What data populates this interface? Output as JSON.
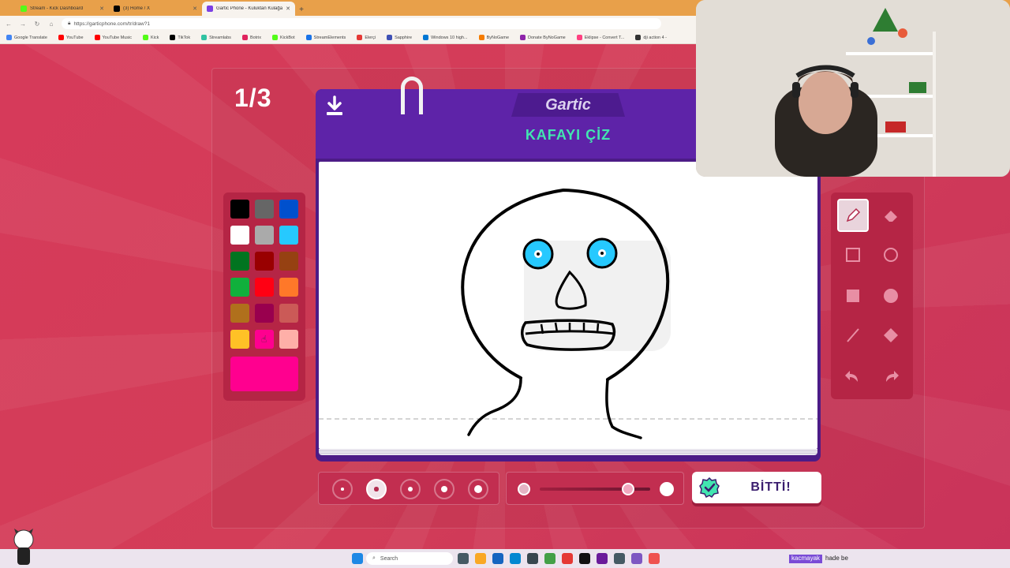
{
  "browser": {
    "tabs": [
      {
        "title": "Stream - Kick Dashboard",
        "color": "#53fc18",
        "active": false
      },
      {
        "title": "(3) Home / X",
        "color": "#000000",
        "active": false
      },
      {
        "title": "Gartic Phone - Kuluktan Kulağa",
        "color": "#7b3fe4",
        "active": true
      }
    ],
    "new_tab": "+",
    "url": "https://garticphone.com/tr/draw?1",
    "bookmarks": [
      {
        "label": "Google Translate",
        "color": "#4285f4"
      },
      {
        "label": "YouTube",
        "color": "#ff0000"
      },
      {
        "label": "YouTube Music",
        "color": "#ff0000"
      },
      {
        "label": "Kick",
        "color": "#53fc18"
      },
      {
        "label": "TikTok",
        "color": "#000000"
      },
      {
        "label": "Streamlabs",
        "color": "#31c3a2"
      },
      {
        "label": "Botrix",
        "color": "#e0245e"
      },
      {
        "label": "KickBot",
        "color": "#53fc18"
      },
      {
        "label": "StreamElements",
        "color": "#1a73e8"
      },
      {
        "label": "Elerçi",
        "color": "#e53935"
      },
      {
        "label": "Sapphire",
        "color": "#3f51b5"
      },
      {
        "label": "Windows 10 high...",
        "color": "#0078d4"
      },
      {
        "label": "ByNoGame",
        "color": "#f57c00"
      },
      {
        "label": "Donate ByNoGame",
        "color": "#8e24aa"
      },
      {
        "label": "Eklipse - Convert T...",
        "color": "#ff4081"
      },
      {
        "label": "dji action 4 -",
        "color": "#333333"
      }
    ]
  },
  "game": {
    "round_counter": "1/3",
    "logo": "Gartic",
    "prompt": "KAFAYI ÇİZ",
    "done_label": "BİTTİ!",
    "palette": [
      "#000000",
      "#666666",
      "#0050cd",
      "#ffffff",
      "#aaaaaa",
      "#26c9ff",
      "#017420",
      "#990000",
      "#964112",
      "#11b03c",
      "#ff0013",
      "#ff7829",
      "#b0701c",
      "#99004e",
      "#cb5a57",
      "#ffc126",
      "#ff008f",
      "#feafa8"
    ],
    "current_color": "#ff008f",
    "tools": [
      "pencil-icon",
      "eraser-icon",
      "rectangle-outline-icon",
      "circle-outline-icon",
      "rectangle-fill-icon",
      "circle-fill-icon",
      "line-icon",
      "fill-bucket-icon",
      "undo-icon",
      "redo-icon"
    ],
    "selected_tool": "pencil-icon",
    "brush_sizes": [
      1,
      2,
      3,
      4,
      5
    ],
    "selected_brush_size": 2,
    "opacity_level": 0.8
  },
  "taskbar": {
    "search_placeholder": "Search",
    "chat_user": "kacmayak",
    "chat_message": "hade be"
  }
}
